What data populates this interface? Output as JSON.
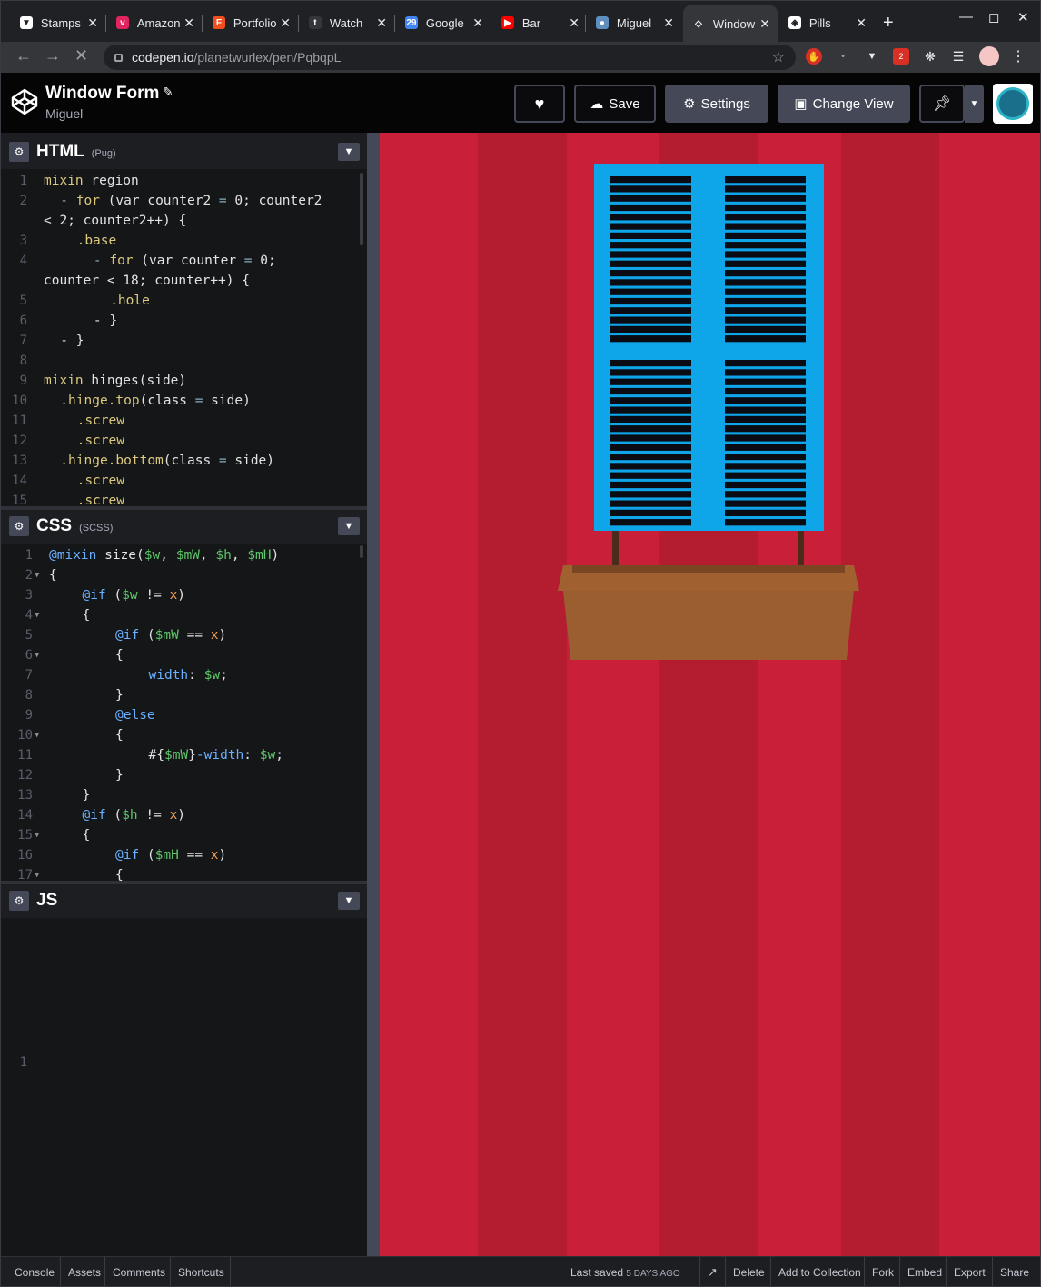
{
  "browser": {
    "tabs": [
      {
        "title": "Stamps",
        "fav_color": "#ffffff",
        "fav_glyph": "▼"
      },
      {
        "title": "Amazon",
        "fav_color": "#e0245e",
        "fav_glyph": "v"
      },
      {
        "title": "Portfolio",
        "fav_color": "#f24e1e",
        "fav_glyph": "F"
      },
      {
        "title": "Watch",
        "fav_color": "#35363a",
        "fav_glyph": "t"
      },
      {
        "title": "Google",
        "fav_color": "#4285f4",
        "fav_glyph": "29"
      },
      {
        "title": "Bar",
        "fav_color": "#ff0000",
        "fav_glyph": "▶"
      },
      {
        "title": "Miguel",
        "fav_color": "#5f8fbf",
        "fav_glyph": "●"
      },
      {
        "title": "Window",
        "fav_color": "#35363a",
        "fav_glyph": "◇"
      },
      {
        "title": "Pills",
        "fav_color": "#ffffff",
        "fav_glyph": "◈"
      }
    ],
    "url_host": "codepen.io",
    "url_path": "/planetwurlex/pen/PqbqpL",
    "extension_badge": "2"
  },
  "header": {
    "title": "Window Form",
    "author": "Miguel",
    "save_label": "Save",
    "settings_label": "Settings",
    "change_view_label": "Change View"
  },
  "html_pane": {
    "lang": "HTML",
    "preprocessor": "(Pug)",
    "lines": [
      {
        "n": "1",
        "indent": 0,
        "segs": [
          [
            "c-kw",
            "mixin"
          ],
          [
            "c-tx",
            " region"
          ]
        ]
      },
      {
        "n": "2",
        "indent": 1,
        "segs": [
          [
            "c-op",
            "- "
          ],
          [
            "c-kw",
            "for"
          ],
          [
            "c-tx",
            " (var counter2 "
          ],
          [
            "c-op",
            "="
          ],
          [
            "c-tx",
            " 0; counter2"
          ]
        ]
      },
      {
        "n": "",
        "indent": 0,
        "segs": [
          [
            "c-tx",
            "< 2; counter2++) {"
          ]
        ]
      },
      {
        "n": "3",
        "indent": 2,
        "segs": [
          [
            "c-cl",
            ".base"
          ]
        ]
      },
      {
        "n": "4",
        "indent": 3,
        "segs": [
          [
            "c-op",
            "- "
          ],
          [
            "c-kw",
            "for"
          ],
          [
            "c-tx",
            " (var counter "
          ],
          [
            "c-op",
            "="
          ],
          [
            "c-tx",
            " 0;"
          ]
        ]
      },
      {
        "n": "",
        "indent": 0,
        "segs": [
          [
            "c-tx",
            "counter < 18; counter++) {"
          ]
        ]
      },
      {
        "n": "5",
        "indent": 4,
        "segs": [
          [
            "c-cl",
            ".hole"
          ]
        ]
      },
      {
        "n": "6",
        "indent": 3,
        "segs": [
          [
            "c-tx",
            "- }"
          ]
        ]
      },
      {
        "n": "7",
        "indent": 1,
        "segs": [
          [
            "c-tx",
            "- }"
          ]
        ]
      },
      {
        "n": "8",
        "indent": 0,
        "segs": []
      },
      {
        "n": "9",
        "indent": 0,
        "segs": [
          [
            "c-kw",
            "mixin"
          ],
          [
            "c-tx",
            " hinges(side)"
          ]
        ]
      },
      {
        "n": "10",
        "indent": 1,
        "segs": [
          [
            "c-cl",
            ".hinge.top"
          ],
          [
            "c-tx",
            "(class "
          ],
          [
            "c-op",
            "="
          ],
          [
            "c-tx",
            " side)"
          ]
        ]
      },
      {
        "n": "11",
        "indent": 2,
        "segs": [
          [
            "c-cl",
            ".screw"
          ]
        ]
      },
      {
        "n": "12",
        "indent": 2,
        "segs": [
          [
            "c-cl",
            ".screw"
          ]
        ]
      },
      {
        "n": "13",
        "indent": 1,
        "segs": [
          [
            "c-cl",
            ".hinge.bottom"
          ],
          [
            "c-tx",
            "(class "
          ],
          [
            "c-op",
            "="
          ],
          [
            "c-tx",
            " side)"
          ]
        ]
      },
      {
        "n": "14",
        "indent": 2,
        "segs": [
          [
            "c-cl",
            ".screw"
          ]
        ]
      },
      {
        "n": "15",
        "indent": 2,
        "segs": [
          [
            "c-cl",
            ".screw"
          ]
        ]
      }
    ]
  },
  "css_pane": {
    "lang": "CSS",
    "preprocessor": "(SCSS)",
    "lines": [
      {
        "n": "1",
        "fold": false,
        "indent": 0,
        "segs": [
          [
            "c-at",
            "@mixin"
          ],
          [
            "c-tx",
            " size("
          ],
          [
            "c-var",
            "$w"
          ],
          [
            "c-tx",
            ", "
          ],
          [
            "c-var",
            "$mW"
          ],
          [
            "c-tx",
            ", "
          ],
          [
            "c-var",
            "$h"
          ],
          [
            "c-tx",
            ", "
          ],
          [
            "c-var",
            "$mH"
          ],
          [
            "c-tx",
            ")"
          ]
        ]
      },
      {
        "n": "2",
        "fold": true,
        "indent": 0,
        "segs": [
          [
            "c-tx",
            "{"
          ]
        ]
      },
      {
        "n": "3",
        "fold": false,
        "indent": 1,
        "segs": [
          [
            "c-at",
            "@if"
          ],
          [
            "c-tx",
            " ("
          ],
          [
            "c-var",
            "$w"
          ],
          [
            "c-tx",
            " != "
          ],
          [
            "c-x",
            "x"
          ],
          [
            "c-tx",
            ")"
          ]
        ]
      },
      {
        "n": "4",
        "fold": true,
        "indent": 1,
        "segs": [
          [
            "c-tx",
            "{"
          ]
        ]
      },
      {
        "n": "5",
        "fold": false,
        "indent": 2,
        "segs": [
          [
            "c-at",
            "@if"
          ],
          [
            "c-tx",
            " ("
          ],
          [
            "c-var",
            "$mW"
          ],
          [
            "c-tx",
            " == "
          ],
          [
            "c-x",
            "x"
          ],
          [
            "c-tx",
            ")"
          ]
        ]
      },
      {
        "n": "6",
        "fold": true,
        "indent": 2,
        "segs": [
          [
            "c-tx",
            "{"
          ]
        ]
      },
      {
        "n": "7",
        "fold": false,
        "indent": 3,
        "segs": [
          [
            "c-prop",
            "width"
          ],
          [
            "c-tx",
            ": "
          ],
          [
            "c-var",
            "$w"
          ],
          [
            "c-tx",
            ";"
          ]
        ]
      },
      {
        "n": "8",
        "fold": false,
        "indent": 2,
        "segs": [
          [
            "c-tx",
            "}"
          ]
        ]
      },
      {
        "n": "9",
        "fold": false,
        "indent": 2,
        "segs": [
          [
            "c-at",
            "@else"
          ]
        ]
      },
      {
        "n": "10",
        "fold": true,
        "indent": 2,
        "segs": [
          [
            "c-tx",
            "{"
          ]
        ]
      },
      {
        "n": "11",
        "fold": false,
        "indent": 3,
        "segs": [
          [
            "c-tx",
            "#{"
          ],
          [
            "c-var",
            "$mW"
          ],
          [
            "c-tx",
            "}"
          ],
          [
            "c-prop",
            "-width"
          ],
          [
            "c-tx",
            ": "
          ],
          [
            "c-var",
            "$w"
          ],
          [
            "c-tx",
            ";"
          ]
        ]
      },
      {
        "n": "12",
        "fold": false,
        "indent": 2,
        "segs": [
          [
            "c-tx",
            "}"
          ]
        ]
      },
      {
        "n": "13",
        "fold": false,
        "indent": 1,
        "segs": [
          [
            "c-tx",
            "}"
          ]
        ]
      },
      {
        "n": "14",
        "fold": false,
        "indent": 1,
        "segs": [
          [
            "c-at",
            "@if"
          ],
          [
            "c-tx",
            " ("
          ],
          [
            "c-var",
            "$h"
          ],
          [
            "c-tx",
            " != "
          ],
          [
            "c-x",
            "x"
          ],
          [
            "c-tx",
            ")"
          ]
        ]
      },
      {
        "n": "15",
        "fold": true,
        "indent": 1,
        "segs": [
          [
            "c-tx",
            "{"
          ]
        ]
      },
      {
        "n": "16",
        "fold": false,
        "indent": 2,
        "segs": [
          [
            "c-at",
            "@if"
          ],
          [
            "c-tx",
            " ("
          ],
          [
            "c-var",
            "$mH"
          ],
          [
            "c-tx",
            " == "
          ],
          [
            "c-x",
            "x"
          ],
          [
            "c-tx",
            ")"
          ]
        ]
      },
      {
        "n": "17",
        "fold": true,
        "indent": 2,
        "segs": [
          [
            "c-tx",
            "{"
          ]
        ]
      }
    ]
  },
  "js_pane": {
    "lang": "JS",
    "lines": [
      {
        "n": "1"
      }
    ]
  },
  "preview": {
    "background": "#c91f38",
    "stripe_color": "#b41c30",
    "shutter_color": "#0ea5e9",
    "slat_color": "#0b0b14",
    "planter_color": "#a0602f",
    "planter_rim_color": "#8b5228"
  },
  "footer": {
    "console": "Console",
    "assets": "Assets",
    "comments": "Comments",
    "shortcuts": "Shortcuts",
    "last_saved_label": "Last saved",
    "last_saved_time": "5 DAYS AGO",
    "delete": "Delete",
    "add_to_collection": "Add to Collection",
    "fork": "Fork",
    "embed": "Embed",
    "export": "Export",
    "share": "Share"
  }
}
